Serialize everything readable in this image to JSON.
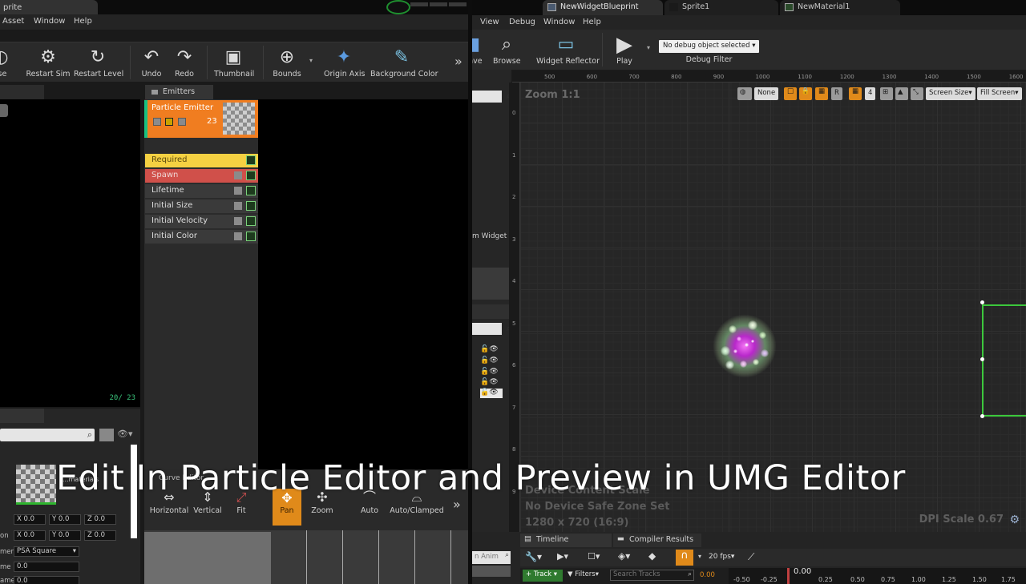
{
  "cascade": {
    "title": "prite",
    "menu": [
      "Asset",
      "Window",
      "Help"
    ],
    "toolbar": [
      {
        "label": "rse",
        "icon": "world-icon"
      },
      {
        "label": "Restart Sim",
        "icon": "gear-icon"
      },
      {
        "label": "Restart Level",
        "icon": "refresh-icon"
      },
      {
        "label": "Undo",
        "icon": "undo-icon"
      },
      {
        "label": "Redo",
        "icon": "redo-icon"
      },
      {
        "label": "Thumbnail",
        "icon": "thumbnail-icon"
      },
      {
        "label": "Bounds",
        "icon": "sphere-icon"
      },
      {
        "label": "Origin Axis",
        "icon": "axis-icon"
      },
      {
        "label": "Background Color",
        "icon": "brush-icon"
      }
    ],
    "emitters_tab": "Emitters",
    "emitter": {
      "name": "Particle Emitter",
      "count": "23"
    },
    "modules": [
      "Required",
      "Spawn",
      "Lifetime",
      "Initial Size",
      "Initial Velocity",
      "Initial Color"
    ],
    "viewport_counter": "20/ 23",
    "material_label": "...materials",
    "props": {
      "rows": [
        {
          "label": "",
          "x": "X 0.0",
          "y": "Y 0.0",
          "z": "Z 0.0"
        },
        {
          "label": "on",
          "x": "X 0.0",
          "y": "Y 0.0",
          "z": "Z 0.0"
        }
      ],
      "alignment_label": "ment",
      "alignment_value": "PSA Square",
      "f1_label": "me",
      "f1_value": "0.0",
      "f2_label": "ame",
      "f2_value": "0.0"
    },
    "curve_label": "Curve Editor",
    "curve_toolbar": [
      "Horizontal",
      "Vertical",
      "Fit",
      "Pan",
      "Zoom",
      "Auto",
      "Auto/Clamped"
    ]
  },
  "umg": {
    "tabs": [
      "NewWidgetBlueprint",
      "Sprite1",
      "NewMaterial1"
    ],
    "menu": [
      "View",
      "Debug",
      "Window",
      "Help"
    ],
    "toolbar": [
      {
        "label": "ave"
      },
      {
        "label": "Browse"
      },
      {
        "label": "Widget Reflector"
      },
      {
        "label": "Play"
      }
    ],
    "debug_select": "No debug object selected",
    "debug_label": "Debug Filter",
    "zoom": "Zoom 1:1",
    "controls": {
      "none": "None",
      "r": "R",
      "grid": "4",
      "screen_size": "Screen Size",
      "fill_screen": "Fill Screen"
    },
    "ruler_top": [
      "500",
      "600",
      "700",
      "800",
      "900",
      "1000",
      "1100",
      "1200",
      "1300",
      "1400",
      "1500",
      "1600"
    ],
    "ruler_left": [
      "0",
      "1",
      "2",
      "3",
      "4",
      "5",
      "6",
      "7",
      "8",
      "9"
    ],
    "left_label": "m Widget",
    "device": {
      "line1": "Device Content Scale",
      "line2": "No Device Safe Zone Set",
      "line3": "1280 x 720 (16:9)"
    },
    "dpi": "DPI Scale 0.67",
    "bottom_tabs": [
      "Timeline",
      "Compiler Results"
    ],
    "anim_search": "n Anim",
    "fps": "20 fps",
    "track_btn": "Track",
    "filters": "Filters",
    "search_tracks": "Search Tracks",
    "time_value": "0.00",
    "time_marker": "0.00",
    "ticks": [
      "-0.50",
      "-0.25",
      "0.25",
      "0.50",
      "0.75",
      "1.00",
      "1.25",
      "1.50",
      "1.75"
    ]
  },
  "caption": "Edit In Particle Editor and Preview in UMG Editor",
  "colors": {
    "emitter": "#f07d20",
    "required": "#f5d142",
    "spawn": "#d0504a",
    "selection": "#3cc83c",
    "accent": "#e08a1a"
  }
}
